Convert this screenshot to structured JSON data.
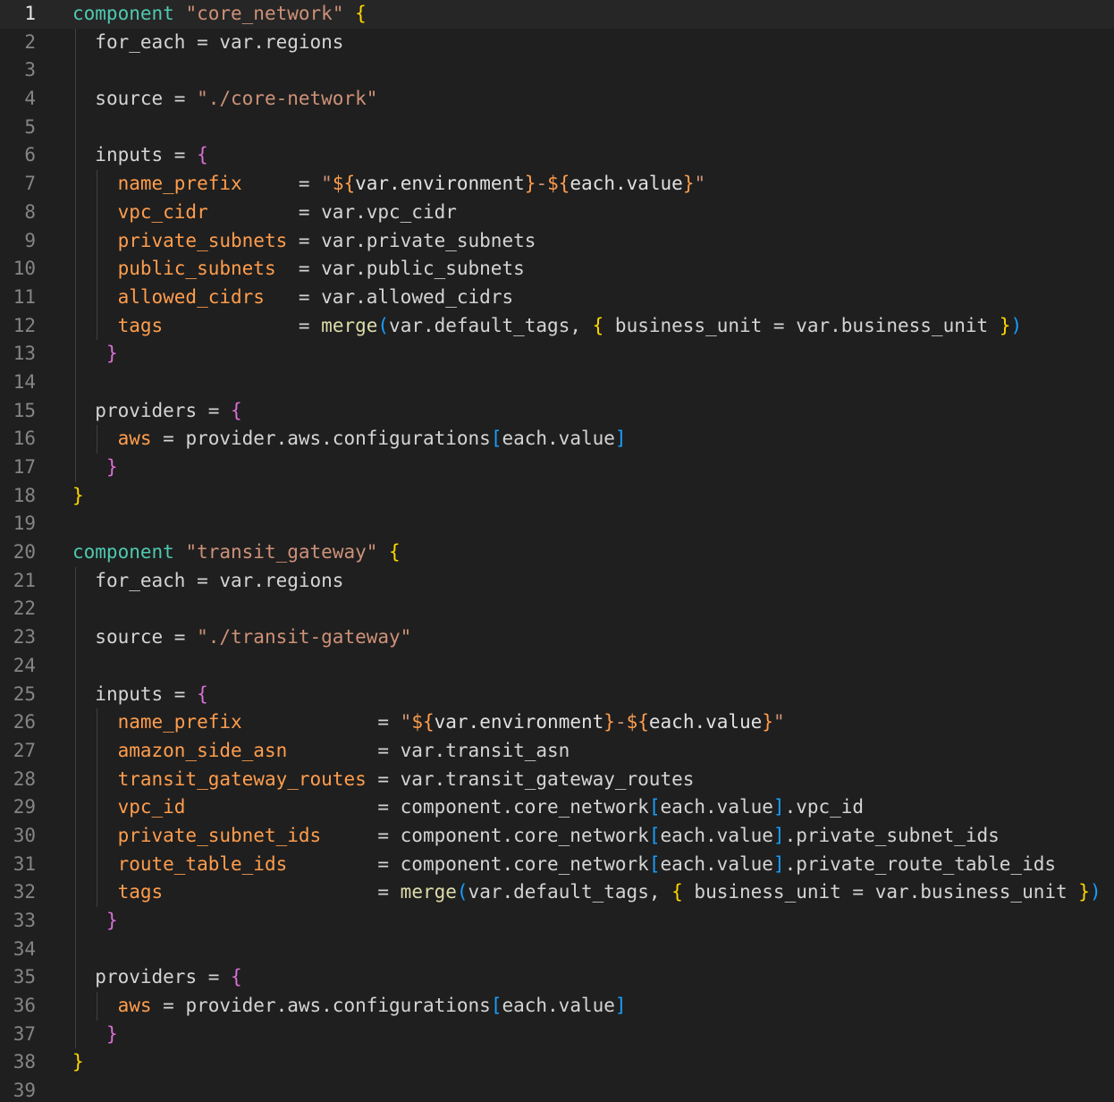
{
  "editor": {
    "active_line": 1,
    "colors": {
      "background": "#1f1f1f",
      "keyword": "#4ec9b0",
      "string": "#ce9178",
      "attribute": "#ff9d4d",
      "function": "#dcdcaa",
      "bracket_level_1": "#ffd700",
      "bracket_level_2": "#da70d6",
      "bracket_level_3": "#179fff",
      "line_number": "#858585"
    },
    "lines": [
      {
        "n": "1",
        "indent": 0,
        "t": [
          [
            "kw",
            "component"
          ],
          [
            "txt",
            " "
          ],
          [
            "str",
            "\"core_network\""
          ],
          [
            "txt",
            " "
          ],
          [
            "b1",
            "{"
          ]
        ]
      },
      {
        "n": "2",
        "indent": 1,
        "t": [
          [
            "txt",
            "for_each = var.regions"
          ]
        ]
      },
      {
        "n": "3",
        "indent": 1,
        "t": []
      },
      {
        "n": "4",
        "indent": 1,
        "t": [
          [
            "txt",
            "source = "
          ],
          [
            "str",
            "\"./core-network\""
          ]
        ]
      },
      {
        "n": "5",
        "indent": 1,
        "t": []
      },
      {
        "n": "6",
        "indent": 1,
        "t": [
          [
            "txt",
            "inputs = "
          ],
          [
            "b2",
            "{"
          ]
        ]
      },
      {
        "n": "7",
        "indent": 2,
        "t": [
          [
            "key",
            "name_prefix"
          ],
          [
            "txt",
            "     = "
          ],
          [
            "str",
            "\""
          ],
          [
            "ip",
            "${"
          ],
          [
            "iv",
            "var.environment"
          ],
          [
            "ip",
            "}"
          ],
          [
            "str",
            "-"
          ],
          [
            "ip",
            "${"
          ],
          [
            "iv",
            "each.value"
          ],
          [
            "ip",
            "}"
          ],
          [
            "str",
            "\""
          ]
        ]
      },
      {
        "n": "8",
        "indent": 2,
        "t": [
          [
            "key",
            "vpc_cidr"
          ],
          [
            "txt",
            "        = var.vpc_cidr"
          ]
        ]
      },
      {
        "n": "9",
        "indent": 2,
        "t": [
          [
            "key",
            "private_subnets"
          ],
          [
            "txt",
            " = var.private_subnets"
          ]
        ]
      },
      {
        "n": "10",
        "indent": 2,
        "t": [
          [
            "key",
            "public_subnets"
          ],
          [
            "txt",
            "  = var.public_subnets"
          ]
        ]
      },
      {
        "n": "11",
        "indent": 2,
        "t": [
          [
            "key",
            "allowed_cidrs"
          ],
          [
            "txt",
            "   = var.allowed_cidrs"
          ]
        ]
      },
      {
        "n": "12",
        "indent": 2,
        "t": [
          [
            "key",
            "tags"
          ],
          [
            "txt",
            "            = "
          ],
          [
            "fn",
            "merge"
          ],
          [
            "b3",
            "("
          ],
          [
            "txt",
            "var.default_tags, "
          ],
          [
            "b1",
            "{"
          ],
          [
            "txt",
            " business_unit = var.business_unit "
          ],
          [
            "b1",
            "}"
          ],
          [
            "b3",
            ")"
          ]
        ]
      },
      {
        "n": "13",
        "indent": 1,
        "t": [
          [
            "txt",
            " "
          ],
          [
            "b2",
            "}"
          ]
        ]
      },
      {
        "n": "14",
        "indent": 1,
        "t": []
      },
      {
        "n": "15",
        "indent": 1,
        "t": [
          [
            "txt",
            "providers = "
          ],
          [
            "b2",
            "{"
          ]
        ]
      },
      {
        "n": "16",
        "indent": 2,
        "t": [
          [
            "key",
            "aws"
          ],
          [
            "txt",
            " = provider.aws.configurations"
          ],
          [
            "b3",
            "["
          ],
          [
            "txt",
            "each.value"
          ],
          [
            "b3",
            "]"
          ]
        ]
      },
      {
        "n": "17",
        "indent": 1,
        "t": [
          [
            "txt",
            " "
          ],
          [
            "b2",
            "}"
          ]
        ]
      },
      {
        "n": "18",
        "indent": 0,
        "t": [
          [
            "b1",
            "}"
          ]
        ]
      },
      {
        "n": "19",
        "indent": 0,
        "t": []
      },
      {
        "n": "20",
        "indent": 0,
        "t": [
          [
            "kw",
            "component"
          ],
          [
            "txt",
            " "
          ],
          [
            "str",
            "\"transit_gateway\""
          ],
          [
            "txt",
            " "
          ],
          [
            "b1",
            "{"
          ]
        ]
      },
      {
        "n": "21",
        "indent": 1,
        "t": [
          [
            "txt",
            "for_each = var.regions"
          ]
        ]
      },
      {
        "n": "22",
        "indent": 1,
        "t": []
      },
      {
        "n": "23",
        "indent": 1,
        "t": [
          [
            "txt",
            "source = "
          ],
          [
            "str",
            "\"./transit-gateway\""
          ]
        ]
      },
      {
        "n": "24",
        "indent": 1,
        "t": []
      },
      {
        "n": "25",
        "indent": 1,
        "t": [
          [
            "txt",
            "inputs = "
          ],
          [
            "b2",
            "{"
          ]
        ]
      },
      {
        "n": "26",
        "indent": 2,
        "t": [
          [
            "key",
            "name_prefix"
          ],
          [
            "txt",
            "            = "
          ],
          [
            "str",
            "\""
          ],
          [
            "ip",
            "${"
          ],
          [
            "iv",
            "var.environment"
          ],
          [
            "ip",
            "}"
          ],
          [
            "str",
            "-"
          ],
          [
            "ip",
            "${"
          ],
          [
            "iv",
            "each.value"
          ],
          [
            "ip",
            "}"
          ],
          [
            "str",
            "\""
          ]
        ]
      },
      {
        "n": "27",
        "indent": 2,
        "t": [
          [
            "key",
            "amazon_side_asn"
          ],
          [
            "txt",
            "        = var.transit_asn"
          ]
        ]
      },
      {
        "n": "28",
        "indent": 2,
        "t": [
          [
            "key",
            "transit_gateway_routes"
          ],
          [
            "txt",
            " = var.transit_gateway_routes"
          ]
        ]
      },
      {
        "n": "29",
        "indent": 2,
        "t": [
          [
            "key",
            "vpc_id"
          ],
          [
            "txt",
            "                 = component.core_network"
          ],
          [
            "b3",
            "["
          ],
          [
            "txt",
            "each.value"
          ],
          [
            "b3",
            "]"
          ],
          [
            "txt",
            ".vpc_id"
          ]
        ]
      },
      {
        "n": "30",
        "indent": 2,
        "t": [
          [
            "key",
            "private_subnet_ids"
          ],
          [
            "txt",
            "     = component.core_network"
          ],
          [
            "b3",
            "["
          ],
          [
            "txt",
            "each.value"
          ],
          [
            "b3",
            "]"
          ],
          [
            "txt",
            ".private_subnet_ids"
          ]
        ]
      },
      {
        "n": "31",
        "indent": 2,
        "t": [
          [
            "key",
            "route_table_ids"
          ],
          [
            "txt",
            "        = component.core_network"
          ],
          [
            "b3",
            "["
          ],
          [
            "txt",
            "each.value"
          ],
          [
            "b3",
            "]"
          ],
          [
            "txt",
            ".private_route_table_ids"
          ]
        ]
      },
      {
        "n": "32",
        "indent": 2,
        "t": [
          [
            "key",
            "tags"
          ],
          [
            "txt",
            "                   = "
          ],
          [
            "fn",
            "merge"
          ],
          [
            "b3",
            "("
          ],
          [
            "txt",
            "var.default_tags, "
          ],
          [
            "b1",
            "{"
          ],
          [
            "txt",
            " business_unit = var.business_unit "
          ],
          [
            "b1",
            "}"
          ],
          [
            "b3",
            ")"
          ]
        ]
      },
      {
        "n": "33",
        "indent": 1,
        "t": [
          [
            "txt",
            " "
          ],
          [
            "b2",
            "}"
          ]
        ]
      },
      {
        "n": "34",
        "indent": 1,
        "t": []
      },
      {
        "n": "35",
        "indent": 1,
        "t": [
          [
            "txt",
            "providers = "
          ],
          [
            "b2",
            "{"
          ]
        ]
      },
      {
        "n": "36",
        "indent": 2,
        "t": [
          [
            "key",
            "aws"
          ],
          [
            "txt",
            " = provider.aws.configurations"
          ],
          [
            "b3",
            "["
          ],
          [
            "txt",
            "each.value"
          ],
          [
            "b3",
            "]"
          ]
        ]
      },
      {
        "n": "37",
        "indent": 1,
        "t": [
          [
            "txt",
            " "
          ],
          [
            "b2",
            "}"
          ]
        ]
      },
      {
        "n": "38",
        "indent": 0,
        "t": [
          [
            "b1",
            "}"
          ]
        ]
      },
      {
        "n": "39",
        "indent": 0,
        "t": []
      }
    ]
  }
}
